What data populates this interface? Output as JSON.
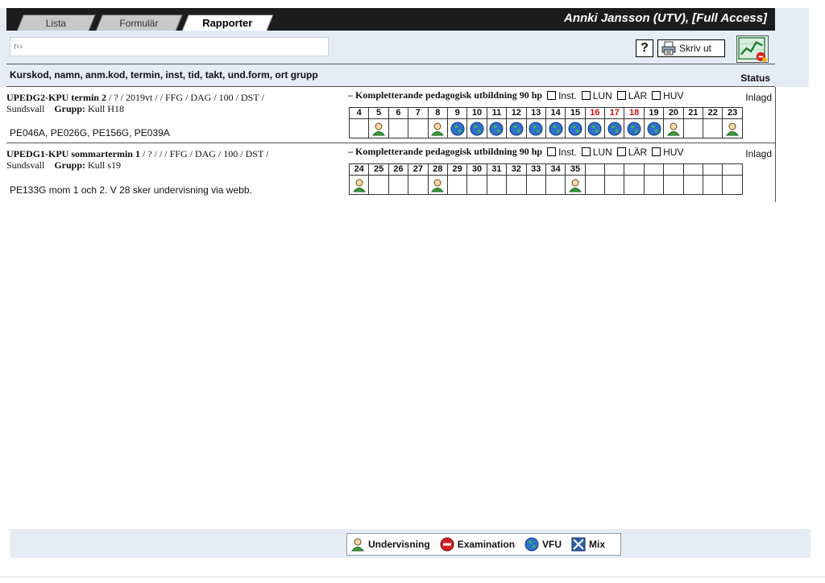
{
  "tabs": [
    {
      "label": "Lista"
    },
    {
      "label": "Formulär"
    },
    {
      "label": "Rapporter",
      "active": true
    }
  ],
  "user": {
    "label": "Annki Jansson (UTV), [Full Access]"
  },
  "search": {
    "value": "",
    "placeholder": "r‹›"
  },
  "toolbar": {
    "help_label": "?",
    "print_label": "Skriv ut"
  },
  "header": {
    "columns_label": "Kurskod, namn, anm.kod, termin, inst, tid, takt, und.form, ort grupp",
    "status_label": "Status"
  },
  "courses": [
    {
      "code": "UPEDG2-KPU termin 2",
      "details": " / ? / 2019vt /  / FFG / DAG / 100 / DST /",
      "ort": "Sundsvall",
      "group_label": "Grupp:",
      "group": "Kull H18",
      "codes": "PE046A, PE026G, PE156G, PE039A",
      "program": "– Kompletterande pedagogisk utbildning 90 hp",
      "checkboxes": [
        "Inst.",
        "LUN",
        "LÄR",
        "HUV"
      ],
      "status": "Inlagd",
      "weeks": [
        {
          "num": "4",
          "icon": ""
        },
        {
          "num": "5",
          "icon": "person-icon"
        },
        {
          "num": "6",
          "icon": ""
        },
        {
          "num": "7",
          "icon": ""
        },
        {
          "num": "8",
          "icon": "person-icon"
        },
        {
          "num": "9",
          "icon": "globe-icon"
        },
        {
          "num": "10",
          "icon": "globe-icon"
        },
        {
          "num": "11",
          "icon": "globe-icon"
        },
        {
          "num": "12",
          "icon": "globe-icon"
        },
        {
          "num": "13",
          "icon": "globe-icon"
        },
        {
          "num": "14",
          "icon": "globe-icon"
        },
        {
          "num": "15",
          "icon": "globe-icon"
        },
        {
          "num": "16",
          "icon": "globe-icon",
          "red": true
        },
        {
          "num": "17",
          "icon": "globe-icon",
          "red": true
        },
        {
          "num": "18",
          "icon": "globe-icon",
          "red": true
        },
        {
          "num": "19",
          "icon": "globe-icon"
        },
        {
          "num": "20",
          "icon": "person-icon"
        },
        {
          "num": "21",
          "icon": ""
        },
        {
          "num": "22",
          "icon": ""
        },
        {
          "num": "23",
          "icon": "person-icon"
        }
      ]
    },
    {
      "code": "UPEDG1-KPU sommartermin 1",
      "details": " / ? /  /  / FFG / DAG / 100 / DST /",
      "ort": "Sundsvall",
      "group_label": "Grupp:",
      "group": "Kull s19",
      "codes": "PE133G mom 1 och 2. V 28 sker undervisning via webb.",
      "program": "– Kompletterande pedagogisk utbildning 90 hp",
      "checkboxes": [
        "Inst.",
        "LUN",
        "LÄR",
        "HUV"
      ],
      "status": "Inlagd",
      "weeks": [
        {
          "num": "24",
          "icon": "person-icon"
        },
        {
          "num": "25",
          "icon": ""
        },
        {
          "num": "26",
          "icon": ""
        },
        {
          "num": "27",
          "icon": ""
        },
        {
          "num": "28",
          "icon": "person-icon"
        },
        {
          "num": "29",
          "icon": ""
        },
        {
          "num": "30",
          "icon": ""
        },
        {
          "num": "31",
          "icon": ""
        },
        {
          "num": "32",
          "icon": ""
        },
        {
          "num": "33",
          "icon": ""
        },
        {
          "num": "34",
          "icon": ""
        },
        {
          "num": "35",
          "icon": "person-icon"
        },
        {
          "num": "",
          "icon": ""
        },
        {
          "num": "",
          "icon": ""
        },
        {
          "num": "",
          "icon": ""
        },
        {
          "num": "",
          "icon": ""
        },
        {
          "num": "",
          "icon": ""
        },
        {
          "num": "",
          "icon": ""
        },
        {
          "num": "",
          "icon": ""
        },
        {
          "num": "",
          "icon": ""
        }
      ]
    }
  ],
  "legend": [
    {
      "icon": "person-icon",
      "label": "Undervisning"
    },
    {
      "icon": "no-entry-icon",
      "label": "Examination"
    },
    {
      "icon": "globe-icon",
      "label": "VFU"
    },
    {
      "icon": "mix-icon",
      "label": "Mix"
    }
  ],
  "colors": {
    "header_bg": "#1c1c1c",
    "frame_bg": "#e4ecf6",
    "highlight_week": "#d01010"
  }
}
